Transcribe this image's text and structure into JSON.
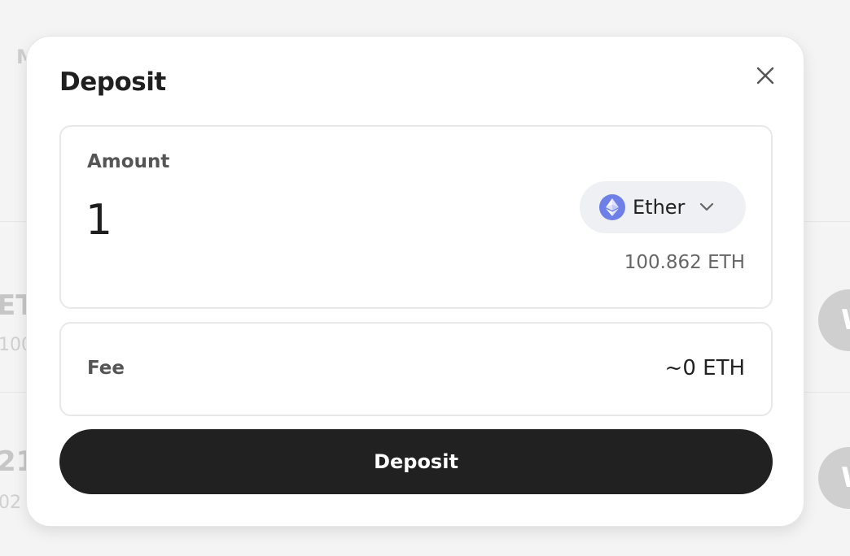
{
  "background": {
    "header_initial": "M",
    "rows": [
      {
        "title": "ET",
        "subtitle": "100",
        "action_initial": "W"
      },
      {
        "title": "21.",
        "subtitle": "02",
        "action_initial": "W"
      }
    ]
  },
  "modal": {
    "title": "Deposit",
    "close_icon": "close-icon",
    "amount": {
      "label": "Amount",
      "value": "1",
      "token": {
        "icon": "ethereum-icon",
        "label": "Ether",
        "chevron": "chevron-down-icon"
      },
      "balance": "100.862 ETH"
    },
    "fee": {
      "label": "Fee",
      "value": "~0 ETH"
    },
    "submit_label": "Deposit"
  },
  "colors": {
    "button": "#212121",
    "token_pill": "#eef0f3",
    "eth_brand": "#6f7fe8"
  }
}
